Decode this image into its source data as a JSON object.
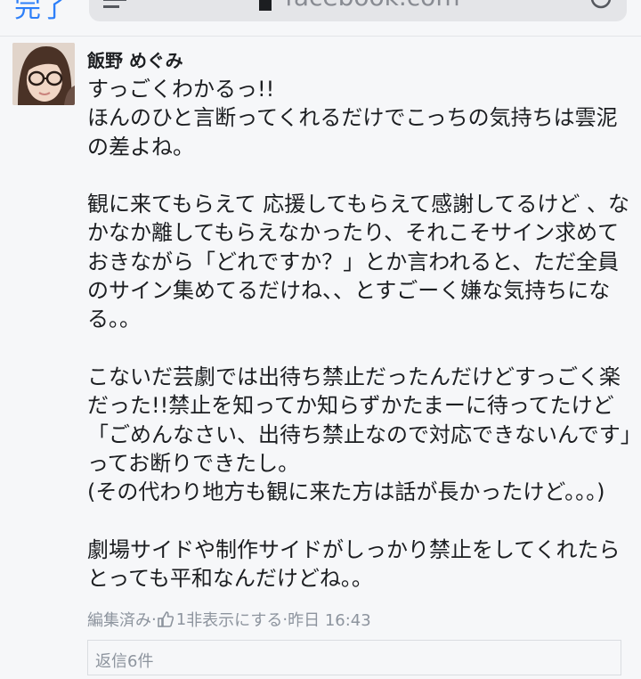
{
  "browser": {
    "done_label": "完了",
    "url": "facebook.com"
  },
  "comment": {
    "author": "飯野 めぐみ",
    "body": "すっごくわかるっ!!\nほんのひと言断ってくれるだけでこっちの気持ちは雲泥の差よね。\n\n観に来てもらえて 応援してもらえて感謝してるけど 、なかなか離してもらえなかったり、それこそサイン求めておきながら「どれですか？」とか言われると、ただ全員のサイン集めてるだけね、、とすごーく嫌な気持ちになる。。\n\nこないだ芸劇では出待ち禁止だったんだけどすっごく楽だった!!禁止を知ってか知らずかたまーに待ってたけど「ごめんなさい、出待ち禁止なので対応できないんです」ってお断りできたし。\n(その代わり地方も観に来た方は話が長かったけど。。。)\n\n劇場サイドや制作サイドがしっかり禁止をしてくれたらとっても平和なんだけどね。。",
    "edited_label": "編集済み",
    "separator": " · ",
    "like_count": "1",
    "hide_label": "非表示にする",
    "timestamp": "昨日 16:43",
    "replies_label": "返信6件"
  },
  "colors": {
    "link_blue": "#2d7ff9",
    "meta_gray": "#8d949e",
    "text": "#1c1e21"
  }
}
